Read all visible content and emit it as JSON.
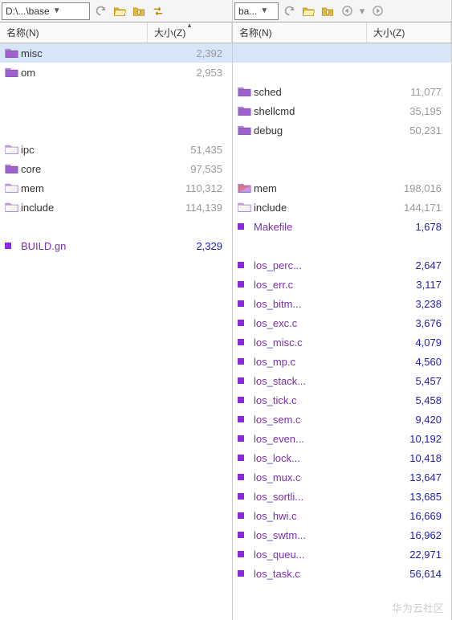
{
  "left": {
    "path": "D:\\...\\base",
    "columns": {
      "name": "名称(N)",
      "size": "大小(Z)"
    },
    "rows": [
      {
        "type": "folder",
        "color": "purple",
        "name": "misc",
        "size": "2,392",
        "selected": true,
        "sizeClass": "gray-num"
      },
      {
        "type": "folder",
        "color": "purple",
        "name": "om",
        "size": "2,953",
        "sizeClass": "gray-num"
      },
      {
        "type": "empty"
      },
      {
        "type": "empty"
      },
      {
        "type": "empty"
      },
      {
        "type": "folder",
        "color": "mix",
        "name": "ipc",
        "size": "51,435",
        "sizeClass": "gray-num"
      },
      {
        "type": "folder",
        "color": "purple",
        "name": "core",
        "size": "97,535",
        "sizeClass": "gray-num"
      },
      {
        "type": "folder",
        "color": "mix",
        "name": "mem",
        "size": "110,312",
        "sizeClass": "gray-num"
      },
      {
        "type": "folder",
        "color": "mix",
        "name": "include",
        "size": "114,139",
        "sizeClass": "gray-num"
      },
      {
        "type": "empty"
      },
      {
        "type": "file",
        "name": "BUILD.gn",
        "size": "2,329",
        "nameClass": "purple-text",
        "sizeClass": "blue-num"
      }
    ]
  },
  "right": {
    "path": "ba...",
    "columns": {
      "name": "名称(N)",
      "size": "大小(Z)"
    },
    "rows": [
      {
        "type": "selected-empty"
      },
      {
        "type": "empty"
      },
      {
        "type": "folder",
        "color": "purple",
        "name": "sched",
        "size": "11,077",
        "sizeClass": "gray-num"
      },
      {
        "type": "folder",
        "color": "purple",
        "name": "shellcmd",
        "size": "35,195",
        "sizeClass": "gray-num"
      },
      {
        "type": "folder",
        "color": "purple",
        "name": "debug",
        "size": "50,231",
        "sizeClass": "gray-num"
      },
      {
        "type": "empty"
      },
      {
        "type": "empty"
      },
      {
        "type": "folder",
        "color": "red",
        "name": "mem",
        "size": "198,016",
        "sizeClass": "gray-num"
      },
      {
        "type": "folder",
        "color": "mix",
        "name": "include",
        "size": "144,171",
        "sizeClass": "gray-num"
      },
      {
        "type": "file",
        "name": "Makefile",
        "size": "1,678",
        "nameClass": "purple-text",
        "sizeClass": "blue-num"
      },
      {
        "type": "empty"
      },
      {
        "type": "file",
        "name": "los_perc...",
        "size": "2,647",
        "nameClass": "purple-text",
        "sizeClass": "blue-num"
      },
      {
        "type": "file",
        "name": "los_err.c",
        "size": "3,117",
        "nameClass": "purple-text",
        "sizeClass": "blue-num"
      },
      {
        "type": "file",
        "name": "los_bitm...",
        "size": "3,238",
        "nameClass": "purple-text",
        "sizeClass": "blue-num"
      },
      {
        "type": "file",
        "name": "los_exc.c",
        "size": "3,676",
        "nameClass": "purple-text",
        "sizeClass": "blue-num"
      },
      {
        "type": "file",
        "name": "los_misc.c",
        "size": "4,079",
        "nameClass": "purple-text",
        "sizeClass": "blue-num"
      },
      {
        "type": "file",
        "name": "los_mp.c",
        "size": "4,560",
        "nameClass": "purple-text",
        "sizeClass": "blue-num"
      },
      {
        "type": "file",
        "name": "los_stack...",
        "size": "5,457",
        "nameClass": "purple-text",
        "sizeClass": "blue-num"
      },
      {
        "type": "file",
        "name": "los_tick.c",
        "size": "5,458",
        "nameClass": "purple-text",
        "sizeClass": "blue-num"
      },
      {
        "type": "file",
        "name": "los_sem.c",
        "size": "9,420",
        "nameClass": "purple-text",
        "sizeClass": "blue-num"
      },
      {
        "type": "file",
        "name": "los_even...",
        "size": "10,192",
        "nameClass": "purple-text",
        "sizeClass": "blue-num"
      },
      {
        "type": "file",
        "name": "los_lock...",
        "size": "10,418",
        "nameClass": "purple-text",
        "sizeClass": "blue-num"
      },
      {
        "type": "file",
        "name": "los_mux.c",
        "size": "13,647",
        "nameClass": "purple-text",
        "sizeClass": "blue-num"
      },
      {
        "type": "file",
        "name": "los_sortli...",
        "size": "13,685",
        "nameClass": "purple-text",
        "sizeClass": "blue-num"
      },
      {
        "type": "file",
        "name": "los_hwi.c",
        "size": "16,669",
        "nameClass": "purple-text",
        "sizeClass": "blue-num"
      },
      {
        "type": "file",
        "name": "los_swtm...",
        "size": "16,962",
        "nameClass": "purple-text",
        "sizeClass": "blue-num"
      },
      {
        "type": "file",
        "name": "los_queu...",
        "size": "22,971",
        "nameClass": "purple-text",
        "sizeClass": "blue-num"
      },
      {
        "type": "file",
        "name": "los_task.c",
        "size": "56,614",
        "nameClass": "purple-text",
        "sizeClass": "blue-num"
      }
    ]
  },
  "watermark": "华为云社区"
}
